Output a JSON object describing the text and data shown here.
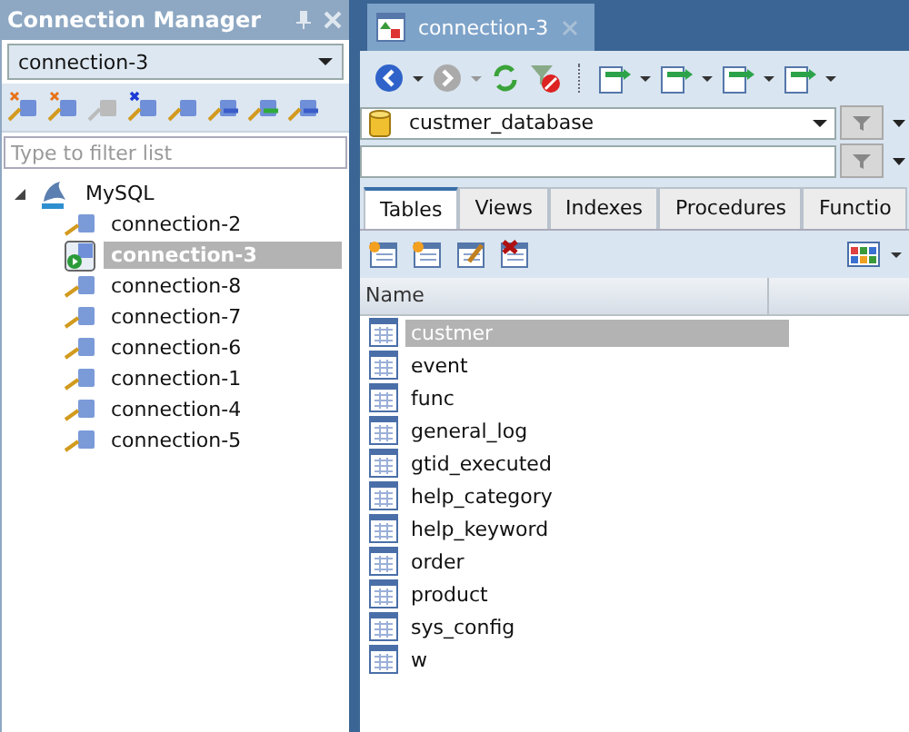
{
  "connection_manager": {
    "title": "Connection Manager",
    "connection_select": {
      "value": "connection-3"
    },
    "filter": {
      "placeholder": "Type to filter list"
    },
    "tree": [
      {
        "label": "MySQL",
        "expanded": true,
        "selected": false,
        "children": [
          {
            "label": "connection-2",
            "selected": false,
            "active": false
          },
          {
            "label": "connection-3",
            "selected": true,
            "active": true
          },
          {
            "label": "connection-8",
            "selected": false,
            "active": false
          },
          {
            "label": "connection-7",
            "selected": false,
            "active": false
          },
          {
            "label": "connection-6",
            "selected": false,
            "active": false
          },
          {
            "label": "connection-1",
            "selected": false,
            "active": false
          },
          {
            "label": "connection-4",
            "selected": false,
            "active": false
          },
          {
            "label": "connection-5",
            "selected": false,
            "active": false
          }
        ]
      }
    ]
  },
  "document_tab": {
    "label": "connection-3",
    "selected": true
  },
  "database_select": {
    "value": "custmer_database"
  },
  "object_tabs": [
    {
      "label": "Tables",
      "selected": true
    },
    {
      "label": "Views",
      "selected": false
    },
    {
      "label": "Indexes",
      "selected": false
    },
    {
      "label": "Procedures",
      "selected": false
    },
    {
      "label": "Functio",
      "selected": false
    }
  ],
  "table": {
    "columns": [
      "Name"
    ],
    "rows": [
      {
        "name": "custmer",
        "selected": true
      },
      {
        "name": "event",
        "selected": false
      },
      {
        "name": "func",
        "selected": false
      },
      {
        "name": "general_log",
        "selected": false
      },
      {
        "name": "gtid_executed",
        "selected": false
      },
      {
        "name": "help_category",
        "selected": false
      },
      {
        "name": "help_keyword",
        "selected": false
      },
      {
        "name": "order",
        "selected": false
      },
      {
        "name": "product",
        "selected": false
      },
      {
        "name": "sys_config",
        "selected": false
      },
      {
        "name": "w",
        "selected": false
      }
    ]
  }
}
